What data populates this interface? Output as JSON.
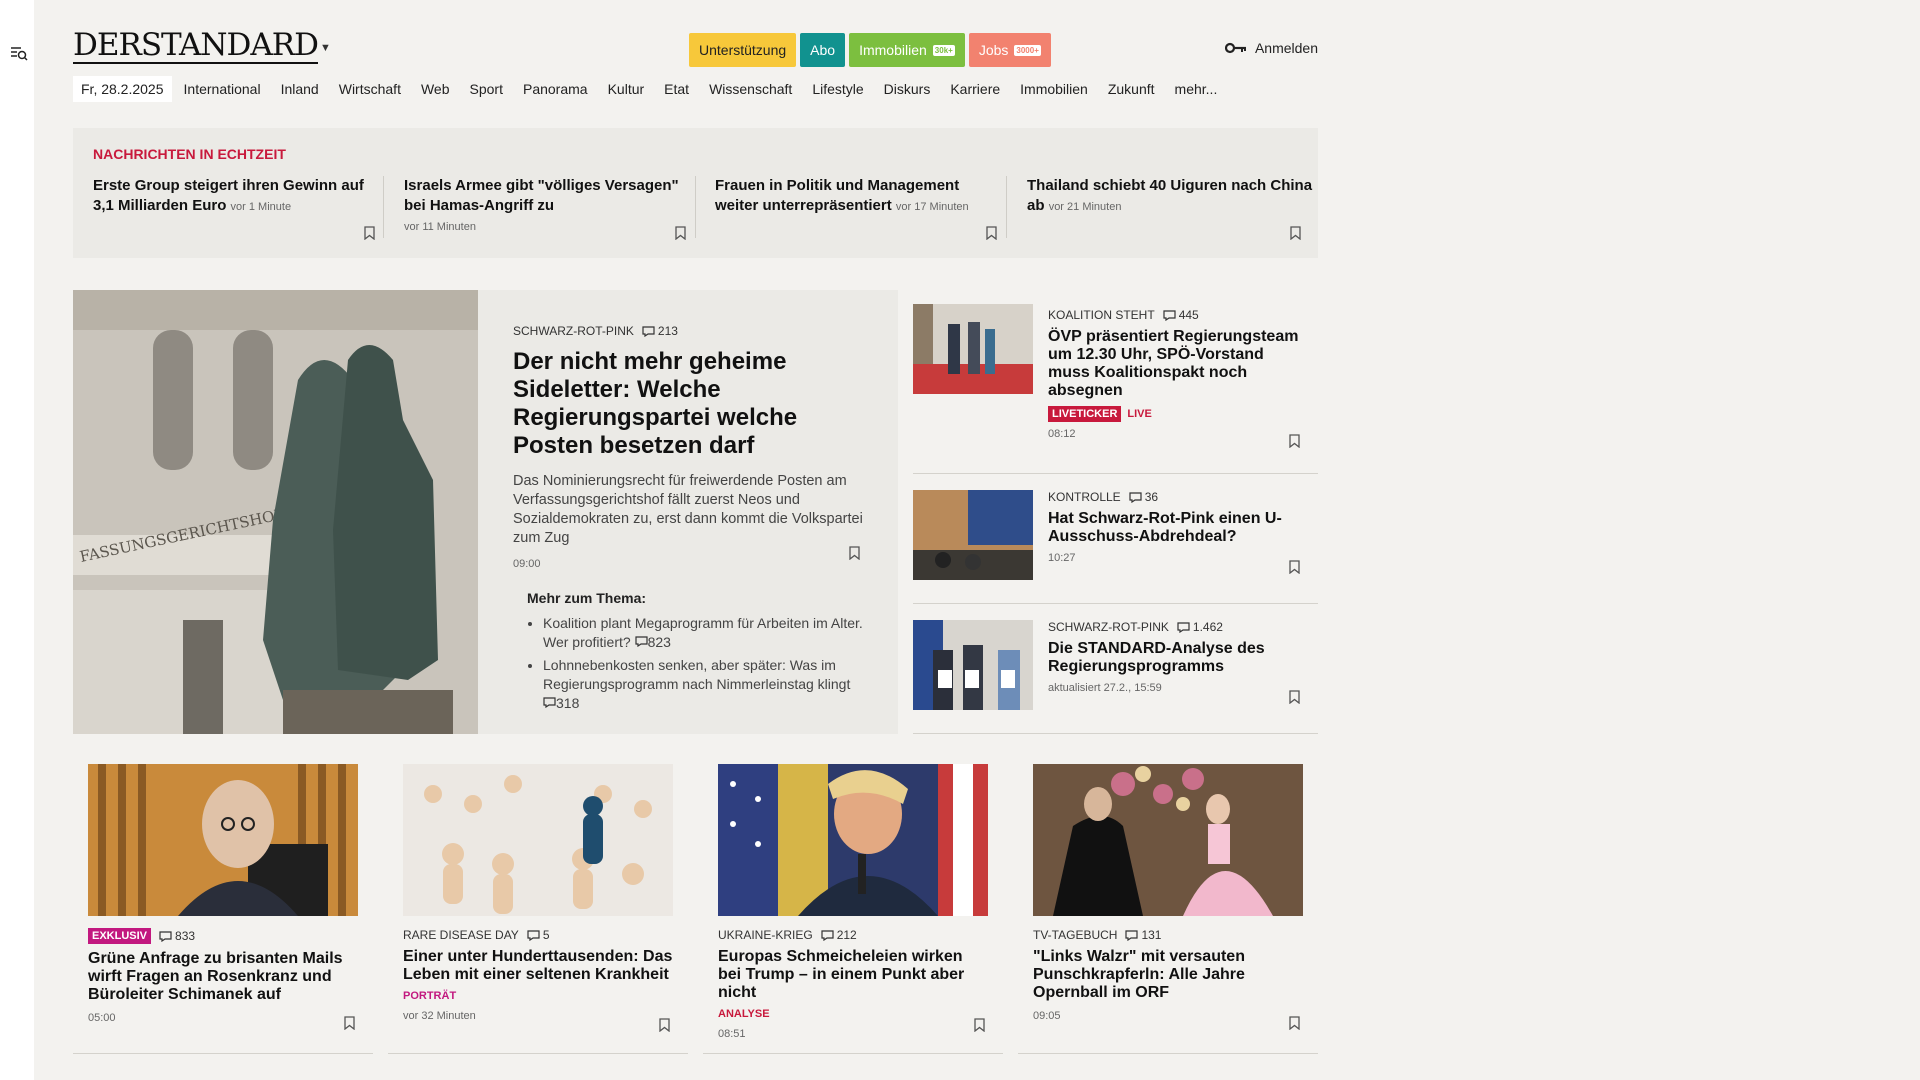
{
  "header": {
    "logo": "DERSTANDARD",
    "pills": [
      {
        "label": "Unterstützung",
        "count": ""
      },
      {
        "label": "Abo",
        "count": ""
      },
      {
        "label": "Immobilien",
        "count": "30k+"
      },
      {
        "label": "Jobs",
        "count": "3000+"
      }
    ],
    "login": "Anmelden"
  },
  "nav": {
    "date": "Fr, 28.2.2025",
    "items": [
      "International",
      "Inland",
      "Wirtschaft",
      "Web",
      "Sport",
      "Panorama",
      "Kultur",
      "Etat",
      "Wissenschaft",
      "Lifestyle",
      "Diskurs",
      "Karriere",
      "Immobilien",
      "Zukunft",
      "mehr..."
    ]
  },
  "ticker": {
    "title": "NACHRICHTEN IN ECHTZEIT",
    "items": [
      {
        "text": "Erste Group steigert ihren Gewinn auf 3,1 Milliarden Euro",
        "time": "vor 1 Minute"
      },
      {
        "text": "Israels Armee gibt \"völliges Versagen\" bei Hamas-Angriff zu",
        "time": "vor 11 Minuten"
      },
      {
        "text": "Frauen in Politik und Management weiter unterrepräsentiert",
        "time": "vor 17 Minuten"
      },
      {
        "text": "Thailand schiebt 40 Uiguren nach China ab",
        "time": "vor 21 Minuten"
      }
    ]
  },
  "hero": {
    "kicker": "SCHWARZ-ROT-PINK",
    "comments": "213",
    "title": "Der nicht mehr geheime Sideletter: Welche Regierungspartei welche Posten besetzen darf",
    "desc": "Das Nominierungsrecht für freiwerdende Posten am Verfassungsgerichtshof fällt zuerst Neos und Sozialdemokraten zu, erst dann kommt die Volkspartei zum Zug",
    "time": "09:00",
    "image_caption": "FASSUNGSGERICHTSHOF",
    "more_title": "Mehr zum Thema:",
    "more": [
      {
        "text": "Koalition plant Megaprogramm für Arbeiten im Alter. Wer profitiert?",
        "comments": "823"
      },
      {
        "text": "Lohnnebenkosten senken, aber später: Was im Regierungsprogramm nach Nimmerleinstag klingt",
        "comments": "318"
      }
    ]
  },
  "side": [
    {
      "kicker": "KOALITION STEHT",
      "comments": "445",
      "title": "ÖVP präsentiert Regierungsteam um 12.30 Uhr, SPÖ-Vorstand muss Koalitionspakt noch absegnen",
      "tag": "LIVETICKER",
      "live": "LIVE",
      "time": "08:12"
    },
    {
      "kicker": "KONTROLLE",
      "comments": "36",
      "title": "Hat Schwarz-Rot-Pink einen U-Ausschuss-Abdrehdeal?",
      "time": "10:27"
    },
    {
      "kicker": "SCHWARZ-ROT-PINK",
      "comments": "1.462",
      "title": "Die STANDARD-Analyse des Regierungsprogramms",
      "time": "aktualisiert 27.2., 15:59"
    }
  ],
  "cards": [
    {
      "badge": "EXKLUSIV",
      "comments": "833",
      "title": "Grüne Anfrage zu brisanten Mails wirft Fragen an Rosenkranz und Büroleiter Schimanek auf",
      "time": "05:00"
    },
    {
      "kicker": "RARE DISEASE DAY",
      "comments": "5",
      "title": "Einer unter Hunderttausenden: Das Leben mit einer seltenen Krankheit",
      "sub": "PORTRÄT",
      "time": "vor 32 Minuten"
    },
    {
      "kicker": "UKRAINE-KRIEG",
      "comments": "212",
      "title": "Europas Schmeicheleien wirken bei Trump – in einem Punkt aber nicht",
      "sub": "ANALYSE",
      "time": "08:51"
    },
    {
      "kicker": "TV-TAGEBUCH",
      "comments": "131",
      "title": "\"Links Walzr\" mit versauten Punschkrapferln: Alle Jahre Opernball im ORF",
      "time": "09:05"
    }
  ],
  "colors": {
    "accent": "#c8193c",
    "magenta": "#c2187f",
    "background": "#f3f2ef",
    "panel": "#ebeae6"
  }
}
